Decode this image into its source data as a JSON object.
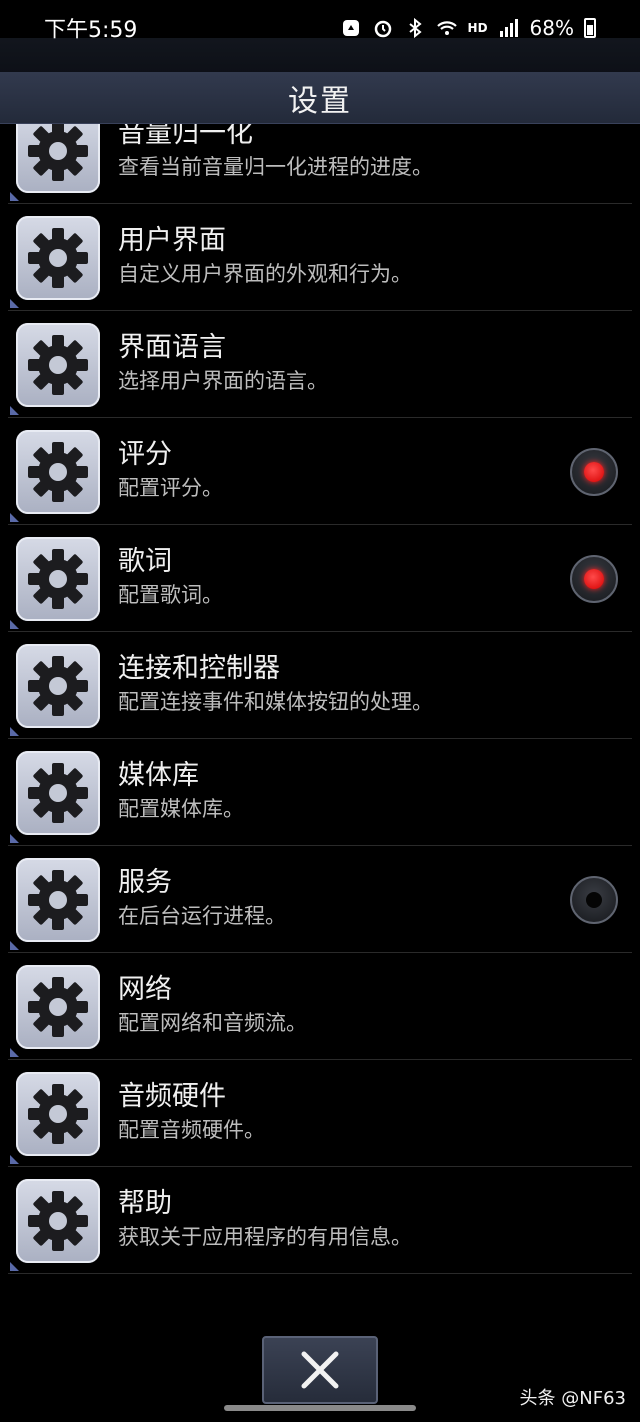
{
  "status_bar": {
    "time": "下午5:59",
    "hd_label": "HD",
    "battery": "68%"
  },
  "header": {
    "title": "设置"
  },
  "settings": [
    {
      "title": "音量归一化",
      "subtitle": "查看当前音量归一化进程的进度。",
      "radio": null
    },
    {
      "title": "用户界面",
      "subtitle": "自定义用户界面的外观和行为。",
      "radio": null
    },
    {
      "title": "界面语言",
      "subtitle": "选择用户界面的语言。",
      "radio": null
    },
    {
      "title": "评分",
      "subtitle": "配置评分。",
      "radio": "on"
    },
    {
      "title": "歌词",
      "subtitle": "配置歌词。",
      "radio": "on"
    },
    {
      "title": "连接和控制器",
      "subtitle": "配置连接事件和媒体按钮的处理。",
      "radio": null
    },
    {
      "title": "媒体库",
      "subtitle": "配置媒体库。",
      "radio": null
    },
    {
      "title": "服务",
      "subtitle": "在后台运行进程。",
      "radio": "off"
    },
    {
      "title": "网络",
      "subtitle": "配置网络和音频流。",
      "radio": null
    },
    {
      "title": "音频硬件",
      "subtitle": "配置音频硬件。",
      "radio": null
    },
    {
      "title": "帮助",
      "subtitle": "获取关于应用程序的有用信息。",
      "radio": null
    }
  ],
  "icons": {
    "row_icon": "gear-icon",
    "close": "close-icon"
  },
  "colors": {
    "radio_on": "#e00000",
    "title_bar": "#2b3244"
  },
  "watermark": "头条 @NF63"
}
